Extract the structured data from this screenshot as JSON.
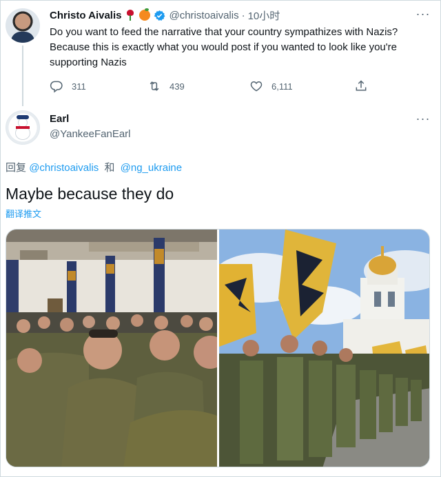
{
  "parent_tweet": {
    "display_name": "Christo Aivalis",
    "emojis": [
      "rose-emoji",
      "orange-emoji"
    ],
    "handle": "@christoaivalis",
    "separator": "·",
    "time": "10小时",
    "text": "Do you want to feed the narrative that your country sympathizes with Nazis? Because this is exactly what you would post if you wanted to look like you're supporting Nazis",
    "replies": "311",
    "retweets": "439",
    "likes": "6,111"
  },
  "reply_tweet": {
    "display_name": "Earl",
    "handle": "@YankeeFanEarl",
    "replying_prefix": "回复",
    "replying_to": [
      "@christoaivalis",
      "@ng_ukraine"
    ],
    "replying_join": "和",
    "text": "Maybe because they do",
    "translate_label": "翻译推文",
    "images": [
      {
        "alt": "Hall of uniformed men seated beneath yellow-and-blue banners"
      },
      {
        "alt": "Formation of soldiers with yellow flags in front of a white church with golden domes"
      }
    ]
  },
  "more_label": "···",
  "colors": {
    "text_primary": "#0f1419",
    "text_secondary": "#536471",
    "accent": "#1d9bf0",
    "border": "#cfd9de",
    "verified": "#1d9bf0"
  },
  "icons": {
    "reply": "reply-icon",
    "retweet": "retweet-icon",
    "like": "heart-icon",
    "share": "share-icon",
    "more": "more-icon",
    "verified": "verified-badge-icon"
  }
}
